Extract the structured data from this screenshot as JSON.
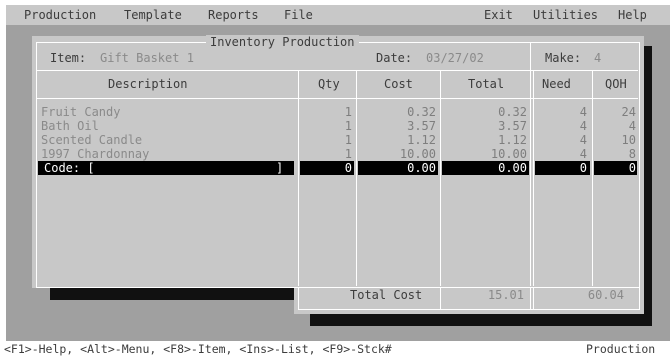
{
  "menubar": {
    "left": [
      "Production",
      "Template",
      "Reports",
      "File"
    ],
    "right": [
      "Exit",
      "Utilities",
      "Help"
    ]
  },
  "window": {
    "title": "Inventory Production",
    "item_label": "Item:",
    "item_value": "Gift Basket 1",
    "date_label": "Date:",
    "date_value": "03/27/02",
    "make_label": "Make:",
    "make_value": "4"
  },
  "table": {
    "headers": [
      "Description",
      "Qty",
      "Cost",
      "Total",
      "Need",
      "QOH"
    ],
    "rows": [
      {
        "description": "Fruit Candy",
        "qty": "1",
        "cost": "0.32",
        "total": "0.32",
        "need": "4",
        "qoh": "24"
      },
      {
        "description": "Bath Oil",
        "qty": "1",
        "cost": "3.57",
        "total": "3.57",
        "need": "4",
        "qoh": "4"
      },
      {
        "description": "Scented Candle",
        "qty": "1",
        "cost": "1.12",
        "total": "1.12",
        "need": "4",
        "qoh": "10"
      },
      {
        "description": "1997 Chardonnay",
        "qty": "1",
        "cost": "10.00",
        "total": "10.00",
        "need": "4",
        "qoh": "8"
      }
    ],
    "edit_row": {
      "code_label": "Code: [",
      "code_close": "]",
      "qty": "0",
      "cost": "0.00",
      "total": "0.00",
      "need": "0",
      "qoh": "0"
    }
  },
  "footer": {
    "total_cost_label": "Total Cost",
    "total_cost_value": "15.01",
    "total_second_value": "60.04"
  },
  "statusbar": {
    "hints": "<F1>-Help, <Alt>-Menu, <F8>-Item, <Ins>-List, <F9>-Stck#",
    "mode": "Production"
  }
}
